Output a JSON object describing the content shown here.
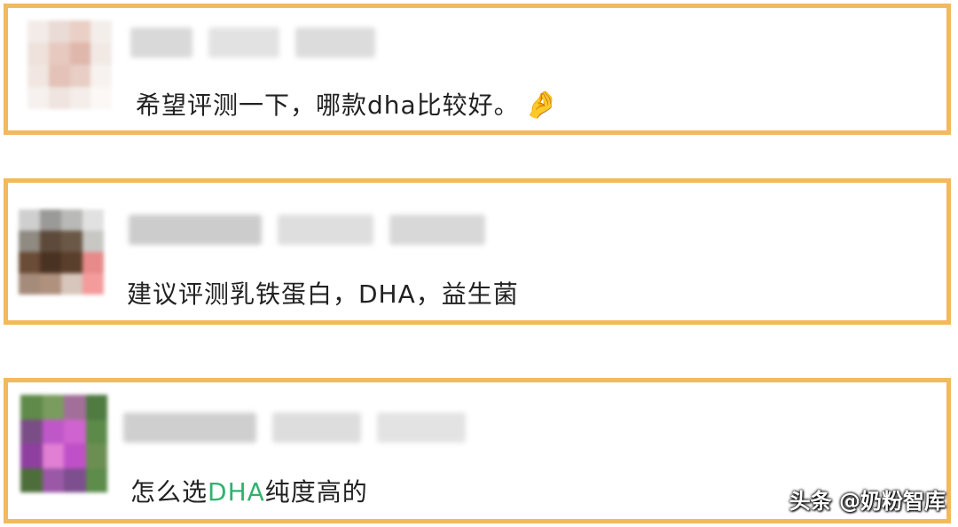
{
  "comments": [
    {
      "text": "希望评测一下，哪款dha比较好。",
      "emoji": "🤌"
    },
    {
      "text": "建议评测乳铁蛋白，DHA，益生菌"
    },
    {
      "pre": "怎么选",
      "highlight": "DHA",
      "post": "纯度高的"
    }
  ],
  "watermark": "头条 @奶粉智库",
  "colors": {
    "border": "#f4b95a",
    "highlight": "#2fb36e",
    "text": "#222222"
  }
}
